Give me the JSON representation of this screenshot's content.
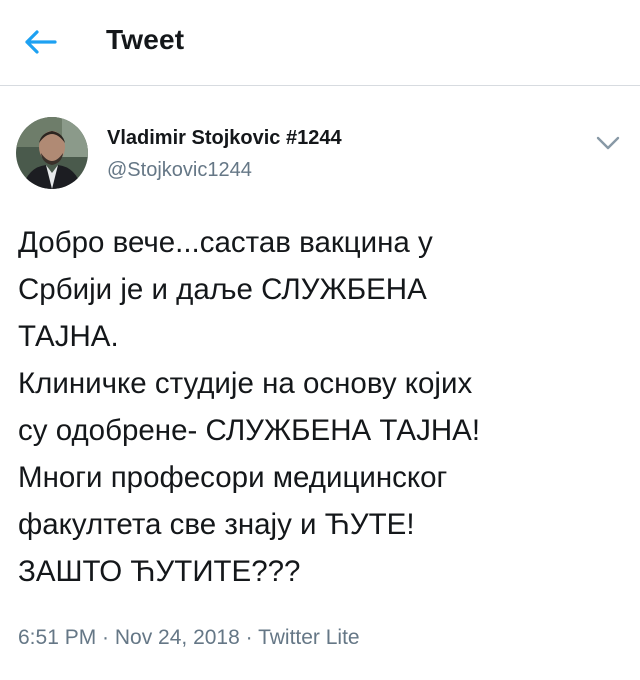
{
  "header": {
    "title": "Tweet",
    "back_icon": "arrow-left-icon",
    "accent_color": "#1da1f2"
  },
  "tweet": {
    "author": {
      "display_name": "Vladimir Stojkovic #1244",
      "handle": "@Stojkovic1244"
    },
    "menu_icon": "chevron-down-icon",
    "text_lines": [
      "Добро вече...састав вакцина у",
      "Србији је и даље СЛУЖБЕНА",
      "ТАЈНА.",
      "Клиничке студије на основу којих",
      "су одобрене- СЛУЖБЕНА ТАЈНА!",
      "Многи професори медицинског",
      "факултета све знају и ЋУТЕ!",
      "ЗАШТО ЋУТИТЕ???"
    ],
    "meta": "6:51 PM · Nov 24, 2018 · Twitter Lite"
  }
}
